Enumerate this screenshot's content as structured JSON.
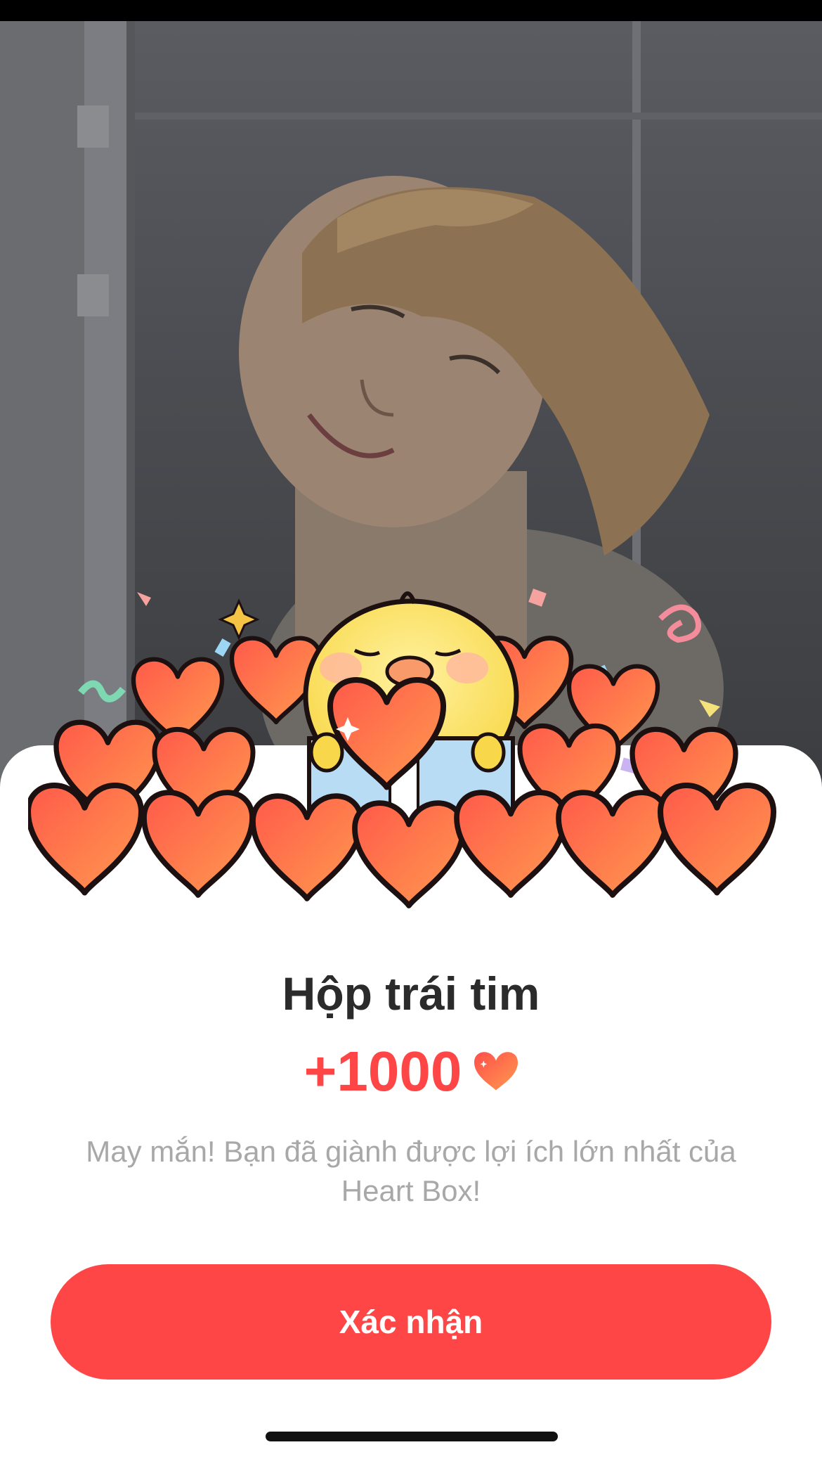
{
  "dialog": {
    "title": "Hộp trái tim",
    "reward_amount": "+1000",
    "reward_icon": "heart-icon",
    "message": "May mắn! Bạn đã giành được lợi ích lớn nhất của Heart Box!",
    "confirm_label": "Xác nhận"
  },
  "colors": {
    "accent": "#fe4646",
    "title": "#2b2b2b",
    "message": "#a8a8a8",
    "sheet": "#ffffff"
  }
}
